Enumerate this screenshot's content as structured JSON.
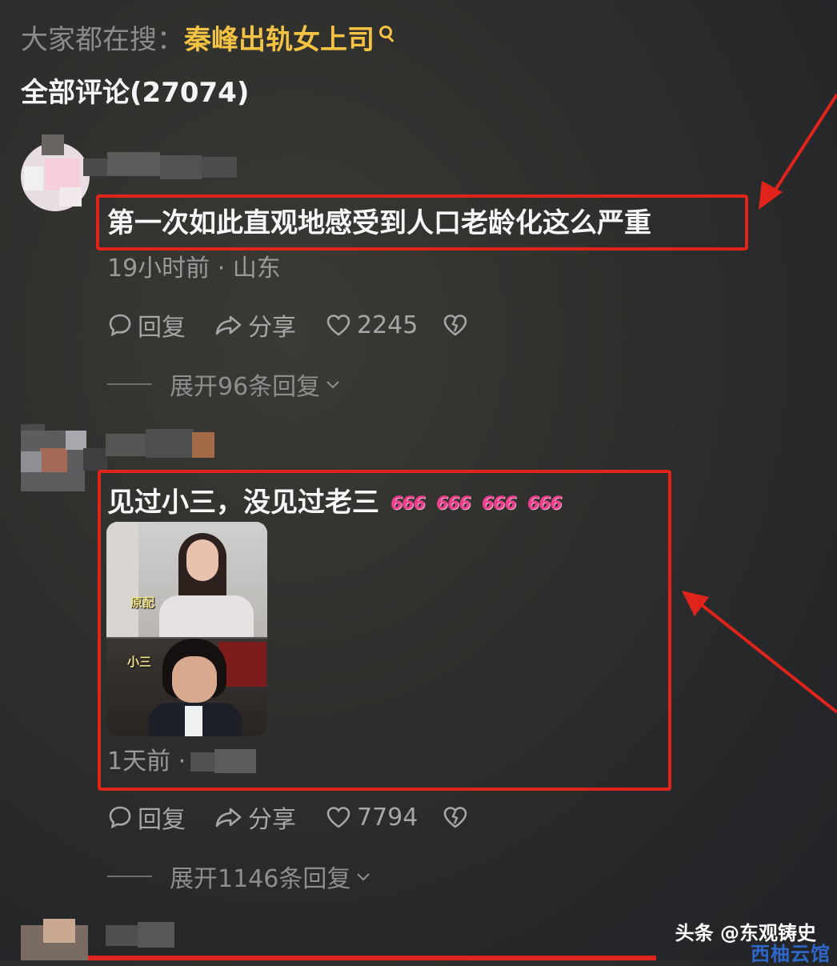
{
  "search": {
    "prefix": "大家都在搜：",
    "term": "秦峰出轨女上司"
  },
  "comments_header": {
    "label": "全部评论(27074)"
  },
  "comments": [
    {
      "text": "第一次如此直观地感受到人口老龄化这么严重",
      "meta": "19小时前 · 山东",
      "reply_label": "回复",
      "share_label": "分享",
      "likes": "2245",
      "expand_label": "展开96条回复"
    },
    {
      "text": "见过小三，没见过老三",
      "emoji_label": "666",
      "image_labels": [
        "原配",
        "小三"
      ],
      "meta": "1天前 ·",
      "reply_label": "回复",
      "share_label": "分享",
      "likes": "7794",
      "expand_label": "展开1146条回复"
    }
  ],
  "watermark": {
    "text": "头条 @东观铸史",
    "corner": "西柚云馆"
  },
  "colors": {
    "highlight": "#e0241c",
    "search_term": "#f5c343",
    "emoji": "#ec3f8c"
  }
}
